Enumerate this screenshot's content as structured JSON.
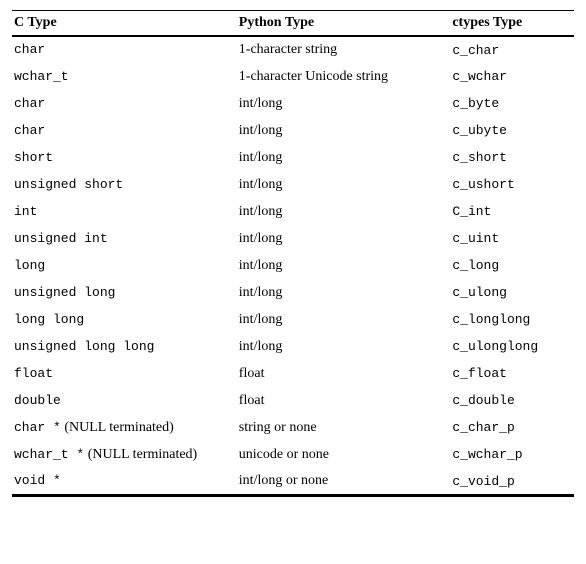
{
  "headers": {
    "c": "C Type",
    "py": "Python Type",
    "ct": "ctypes Type"
  },
  "rows": [
    {
      "c": "char",
      "annot": "",
      "py": "1-character string",
      "ct": "c_char"
    },
    {
      "c": "wchar_t",
      "annot": "",
      "py": "1-character Unicode string",
      "ct": "c_wchar"
    },
    {
      "c": "char",
      "annot": "",
      "py": "int/long",
      "ct": "c_byte"
    },
    {
      "c": "char",
      "annot": "",
      "py": "int/long",
      "ct": "c_ubyte"
    },
    {
      "c": "short",
      "annot": "",
      "py": "int/long",
      "ct": "c_short"
    },
    {
      "c": "unsigned short",
      "annot": "",
      "py": "int/long",
      "ct": "c_ushort"
    },
    {
      "c": "int",
      "annot": "",
      "py": "int/long",
      "ct": "C_int"
    },
    {
      "c": "unsigned int",
      "annot": "",
      "py": "int/long",
      "ct": "c_uint"
    },
    {
      "c": "long",
      "annot": "",
      "py": "int/long",
      "ct": "c_long"
    },
    {
      "c": "unsigned long",
      "annot": "",
      "py": "int/long",
      "ct": "c_ulong"
    },
    {
      "c": "long long",
      "annot": "",
      "py": "int/long",
      "ct": "c_longlong"
    },
    {
      "c": "unsigned long long",
      "annot": "",
      "py": "int/long",
      "ct": "c_ulonglong"
    },
    {
      "c": "float",
      "annot": "",
      "py": "float",
      "ct": "c_float"
    },
    {
      "c": "double",
      "annot": "",
      "py": "float",
      "ct": "c_double"
    },
    {
      "c": "char *",
      "annot": " (NULL terminated)",
      "py": "string or none",
      "ct": "c_char_p"
    },
    {
      "c": "wchar_t *",
      "annot": " (NULL terminated)",
      "py": "unicode or none",
      "ct": "c_wchar_p"
    },
    {
      "c": "void *",
      "annot": "",
      "py": "int/long or none",
      "ct": "c_void_p"
    }
  ]
}
